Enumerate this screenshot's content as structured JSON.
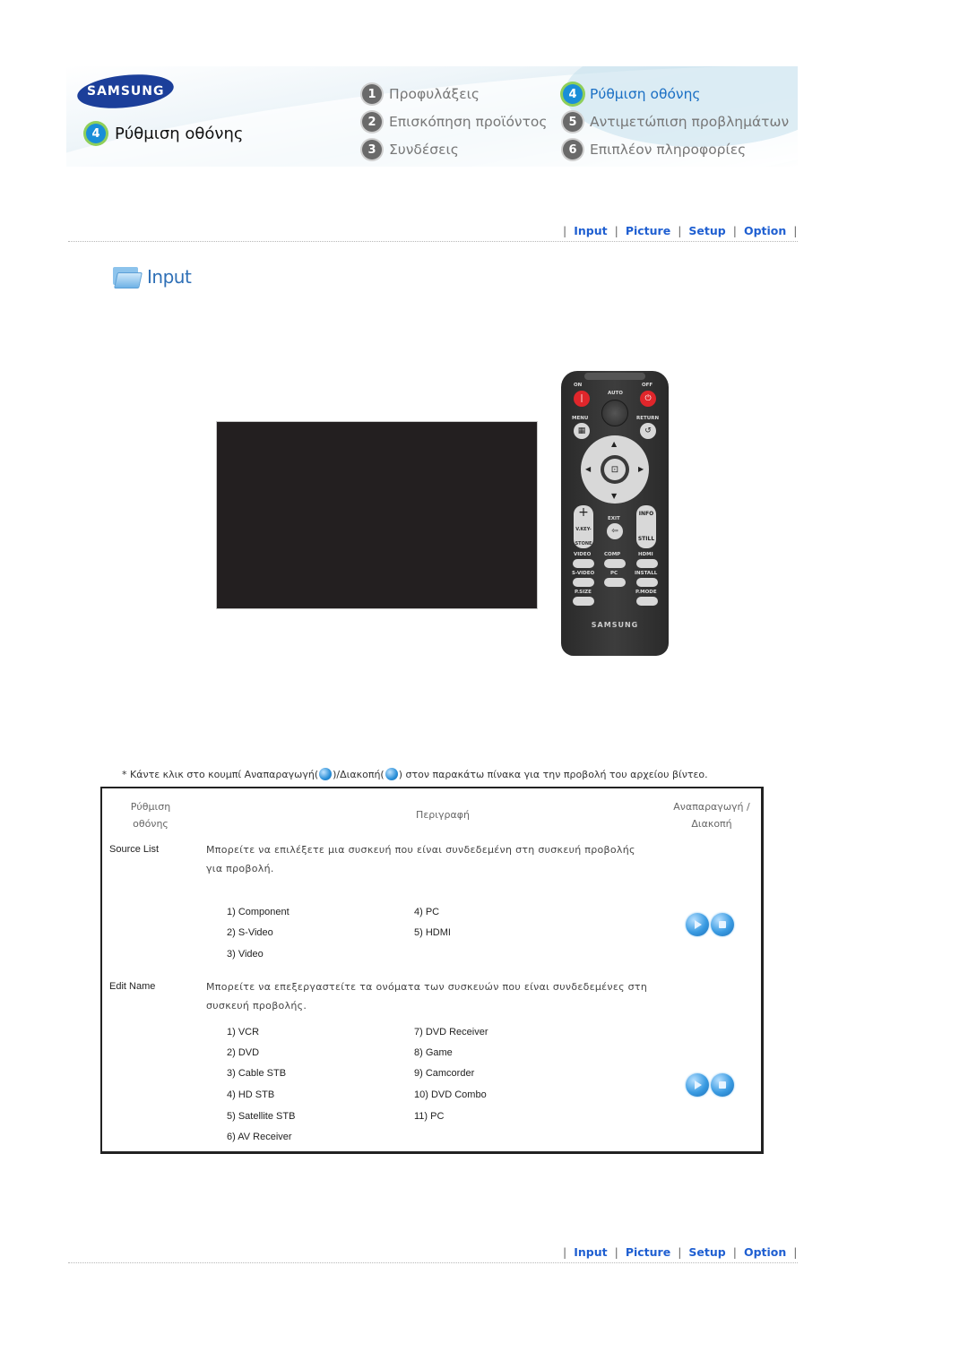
{
  "header": {
    "brand": "SAMSUNG",
    "current_section": {
      "number": "4",
      "title": "Ρύθμιση οθόνης"
    },
    "nav": [
      {
        "number": "1",
        "label": "Προφυλάξεις",
        "current": false
      },
      {
        "number": "2",
        "label": "Επισκόπηση προϊόντος",
        "current": false
      },
      {
        "number": "3",
        "label": "Συνδέσεις",
        "current": false
      },
      {
        "number": "4",
        "label": "Ρύθμιση οθόνης",
        "current": true
      },
      {
        "number": "5",
        "label": "Αντιμετώπιση προβλημάτων",
        "current": false
      },
      {
        "number": "6",
        "label": "Επιπλέον πληροφορίες",
        "current": false
      }
    ]
  },
  "tabs": [
    "Input",
    "Picture",
    "Setup",
    "Option"
  ],
  "section": {
    "title": "Input",
    "icon": "folder-icon"
  },
  "remote": {
    "labels": {
      "on": "ON",
      "off": "OFF",
      "auto": "AUTO",
      "menu": "MENU",
      "return": "RETURN",
      "exit": "EXIT",
      "info": "INFO",
      "still": "STILL",
      "vkeystone": "V.KEY-STONE",
      "video": "VIDEO",
      "comp": "COMP",
      "hdmi": "HDMI",
      "svideo": "S-VIDEO",
      "pc": "PC",
      "install": "INSTALL",
      "psize": "P.SIZE",
      "pmode": "P.MODE",
      "brand": "SAMSUNG"
    }
  },
  "instruction": {
    "prefix": "* Κάντε κλικ στο κουμπί Αναπαραγωγή(",
    "middle": ")/Διακοπή(",
    "suffix": ") στον παρακάτω πίνακα για την προβολή του αρχείου βίντεο."
  },
  "table": {
    "headers": {
      "setting_line1": "Ρύθμιση",
      "setting_line2": "οθόνης",
      "description": "Περιγραφή",
      "play_line1": "Αναπαραγωγή /",
      "play_line2": "Διακοπή"
    },
    "rows": [
      {
        "label": "Source List",
        "description": "Μπορείτε να επιλέξετε μια συσκευή που είναι συνδεδεμένη στη συσκευή προβολής για προβολή.",
        "options_left": [
          "1) Component",
          "2) S-Video",
          "3) Video"
        ],
        "options_right": [
          "4) PC",
          "5) HDMI"
        ]
      },
      {
        "label": "Edit Name",
        "description": "Μπορείτε να επεξεργαστείτε τα ονόματα των συσκευών που είναι συνδεδεμένες στη συσκευή προβολής.",
        "options_left": [
          "1) VCR",
          "2) DVD",
          "3) Cable STB",
          "4) HD STB",
          "5) Satellite STB",
          "6) AV Receiver"
        ],
        "options_right": [
          "7) DVD Receiver",
          "8) Game",
          "9) Camcorder",
          "10) DVD Combo",
          "11) PC"
        ]
      }
    ]
  },
  "colors": {
    "link": "#1f5fd1",
    "active_badge": "#1a8ed8",
    "current_nav": "#1a6fc4",
    "screen": "#231f20",
    "brand_blue": "#1c3f9a"
  }
}
